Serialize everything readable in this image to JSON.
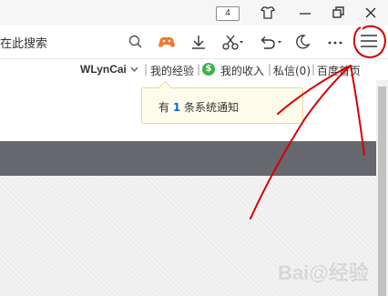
{
  "titlebar": {
    "tab_count": "4"
  },
  "toolbar": {
    "search_text": "在此搜索"
  },
  "subnav": {
    "username": "WLynCai",
    "my_experience": "我的经验",
    "my_income": "我的收入",
    "messages": "私信(0)",
    "baidu_home": "百度首页",
    "separator": "|",
    "income_icon_glyph": "$"
  },
  "notification": {
    "prefix": "有",
    "count": "1",
    "suffix": "条系统通知"
  },
  "watermark": "Bai@经验",
  "colors": {
    "annotation_red": "#d40000",
    "accent_orange": "#f07b2a",
    "link_blue": "#1a66cc",
    "dark_bar": "#66686e"
  },
  "icons": [
    "restore-icon",
    "skin-icon",
    "minimize-icon",
    "maximize-icon",
    "close-icon",
    "search-icon",
    "game-icon",
    "download-icon",
    "scissors-icon",
    "undo-icon",
    "night-mode-icon",
    "more-icon",
    "menu-icon",
    "dollar-icon"
  ]
}
